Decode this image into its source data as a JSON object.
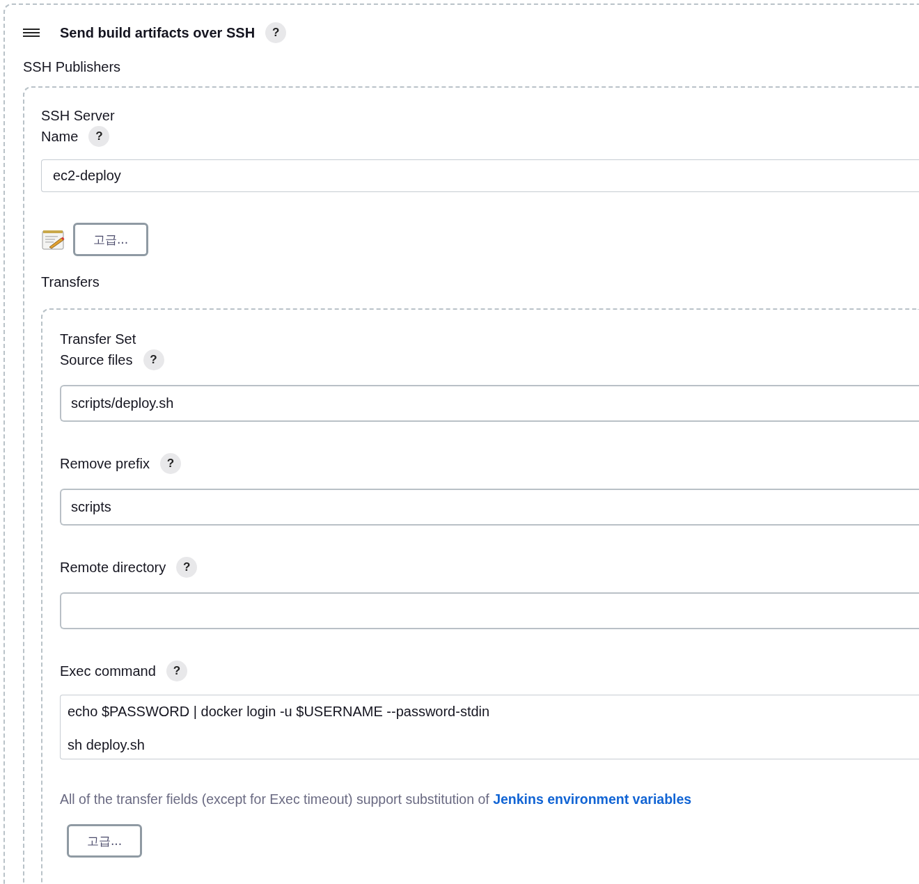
{
  "section": {
    "title": "Send build artifacts over SSH",
    "help": "?"
  },
  "publishers_label": "SSH Publishers",
  "server": {
    "heading": "SSH Server",
    "name_label": "Name",
    "help": "?",
    "name_value": "ec2-deploy",
    "advanced_button": "고급..."
  },
  "transfers_label": "Transfers",
  "transfer_set": {
    "heading": "Transfer Set",
    "fields": [
      {
        "kind": "input",
        "label": "Source files",
        "help": "?",
        "value": "scripts/deploy.sh"
      },
      {
        "kind": "input",
        "label": "Remove prefix",
        "help": "?",
        "value": "scripts"
      },
      {
        "kind": "input",
        "label": "Remote directory",
        "help": "?"
      },
      {
        "kind": "textarea",
        "label": "Exec command",
        "help": "?",
        "lines": [
          "echo $PASSWORD | docker login -u $USERNAME --password-stdin",
          "sh deploy.sh"
        ]
      }
    ],
    "note": "All of the transfer fields (except for Exec timeout) support substitution of ",
    "note_link": "Jenkins environment variables",
    "advanced_button": "고급..."
  }
}
